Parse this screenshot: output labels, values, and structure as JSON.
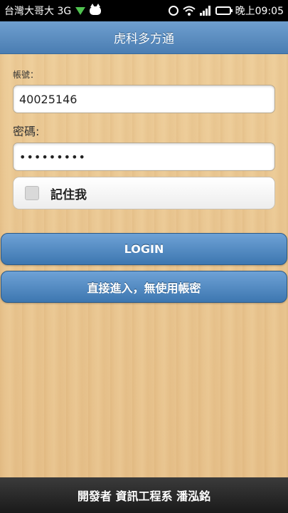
{
  "status_bar": {
    "carrier": "台灣大哥大 3G",
    "time": "晚上09:05",
    "icons": [
      "network-arrow-icon",
      "cat-icon",
      "alarm-icon",
      "wifi-icon",
      "signal-icon",
      "battery-icon"
    ]
  },
  "header": {
    "title": "虎科多方通"
  },
  "form": {
    "account_label": "帳號：",
    "account_value": "40025146",
    "password_label": "密碼:",
    "password_value": "•••••••••",
    "remember_label": "記住我",
    "remember_checked": false
  },
  "buttons": {
    "login": "LOGIN",
    "direct": "直接進入，無使用帳密"
  },
  "footer": {
    "text": "開發者 資訊工程系 潘泓銘"
  },
  "colors": {
    "header": "#5a8cc2",
    "button": "#4f88c2",
    "footer": "#1a1a1a",
    "wood": "#e9c48e"
  }
}
